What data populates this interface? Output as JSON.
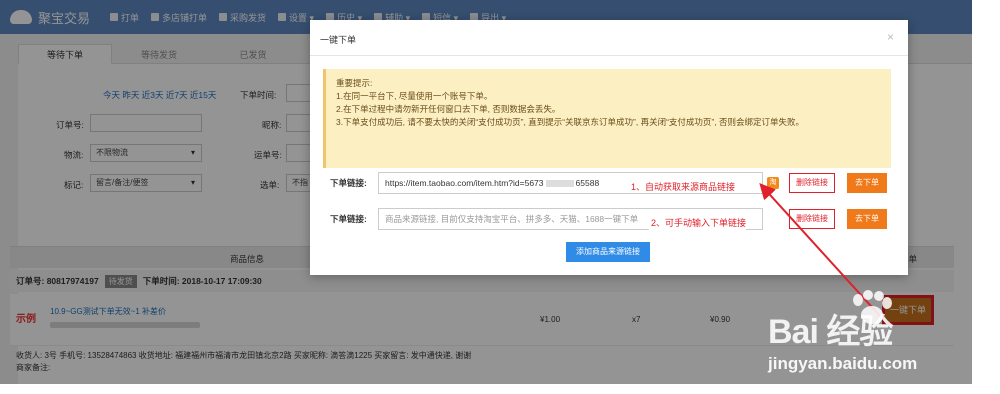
{
  "app": {
    "brand": "聚宝交易"
  },
  "nav": [
    "打单",
    "多店铺打单",
    "采购发货",
    "设置 ▾",
    "历史 ▾",
    "辅助 ▾",
    "短信 ▾",
    "导出 ▾"
  ],
  "tabs": [
    "等待下单",
    "等待发货",
    "已发货"
  ],
  "filters": {
    "quick_dates": "今天 昨天 近3天 近7天 近15天",
    "order_time_label": "下单时间:",
    "order_no_label": "订单号:",
    "nickname_label": "昵称:",
    "logistics_label": "物流:",
    "logistics_value": "不限物流",
    "waybill_label": "运单号:",
    "tag_label": "标记:",
    "tag_value": "留言/备注/便签",
    "select_label": "选单:",
    "select_value": "不指"
  },
  "table": {
    "col_product": "商品信息",
    "col_order": "下单"
  },
  "order": {
    "header": "订单号: 80817974197",
    "status": "待发货",
    "time": "下单时间: 2018-10-17 17:09:30",
    "sample_label": "示例",
    "product_title": "10.9~GG测试下单无效~1  补差价",
    "price": "¥1.00",
    "qty": "x7",
    "total": "¥0.90",
    "action": "一键下单",
    "address_line": "收货人: 3号    手机号: 13528474863    收货地址: 福建福州市福清市龙田镇北京2路    买家昵称: 滴答滴1225    买家留言: 发中通快递, 谢谢",
    "seller_note": "商家备注:"
  },
  "modal": {
    "title": "一键下单",
    "close": "×",
    "notice_title": "重要提示:",
    "notice_lines": [
      "1.在同一平台下, 尽量使用一个账号下单。",
      "2.在下单过程中请勿新开任何窗口去下单, 否则数据会丢失。",
      "3.下单支付成功后, 请不要太快的关闭“支付成功页”, 直到提示“关联京东订单成功”, 再关闭“支付成功页”, 否则会绑定订单失败。"
    ],
    "link_label": "下单链接:",
    "link1_value": "https://item.taobao.com/item.htm?id=5673",
    "link1_suffix": "65588",
    "link1_annotation": "1、自动获取来源商品链接",
    "taobao_icon": "淘",
    "link2_placeholder": "商品来源链接, 目前仅支持淘宝平台、拼多多、天猫、1688一键下单",
    "link2_annotation": "2、可手动输入下单链接",
    "delete_label": "删除链接",
    "order_label": "去下单",
    "add_label": "添加商品来源链接"
  },
  "watermark": {
    "brand": "Bai 经验",
    "url": "jingyan.baidu.com"
  }
}
